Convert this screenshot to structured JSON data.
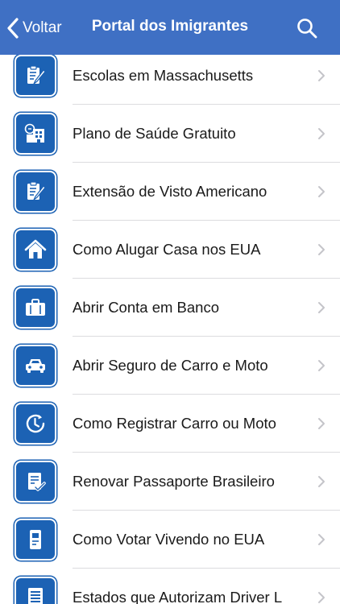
{
  "navbar": {
    "back_label": "Voltar",
    "title": "Portal dos Imigrantes",
    "back_icon": "chevron-left-icon",
    "search_icon": "search-icon",
    "color": "#3f70c4"
  },
  "list": {
    "icon_color": "#1c62b4",
    "items": [
      {
        "label": "Escolas em Massachusetts",
        "icon": "clipboard-pencil-icon"
      },
      {
        "label": "Plano de Saúde Gratuito",
        "icon": "hospital-icon"
      },
      {
        "label": "Extensão de Visto Americano",
        "icon": "clipboard-pencil-icon"
      },
      {
        "label": "Como Alugar Casa nos EUA",
        "icon": "house-icon"
      },
      {
        "label": "Abrir Conta em Banco",
        "icon": "briefcase-icon"
      },
      {
        "label": "Abrir Seguro de Carro e Moto",
        "icon": "car-icon"
      },
      {
        "label": "Como Registrar Carro ou Moto",
        "icon": "clock-icon"
      },
      {
        "label": "Renovar Passaporte Brasileiro",
        "icon": "document-check-icon"
      },
      {
        "label": "Como Votar Vivendo no EUA",
        "icon": "ballot-icon"
      },
      {
        "label": "Estados que Autorizam Driver L",
        "icon": "list-document-icon"
      }
    ]
  }
}
